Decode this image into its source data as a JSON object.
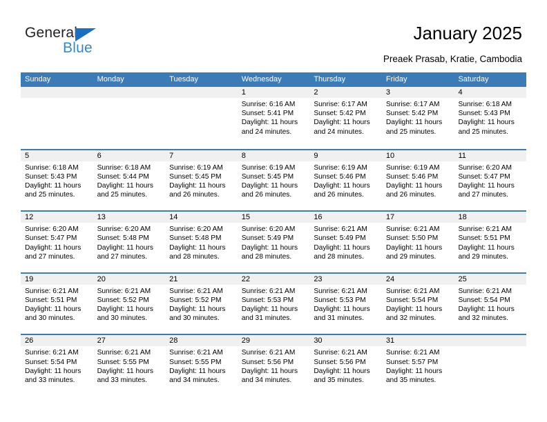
{
  "brand": {
    "name_part1": "General",
    "name_part2": "Blue",
    "triangle_color": "#1b6ec2",
    "blue_color": "#2e8bd0"
  },
  "header": {
    "title": "January 2025",
    "subtitle": "Preaek Prasab, Kratie, Cambodia"
  },
  "theme": {
    "header_blue": "#3b7cb8",
    "day_band_gray": "#f0f0f0"
  },
  "weekdays": [
    "Sunday",
    "Monday",
    "Tuesday",
    "Wednesday",
    "Thursday",
    "Friday",
    "Saturday"
  ],
  "labels": {
    "sunrise_prefix": "Sunrise: ",
    "sunset_prefix": "Sunset: ",
    "daylight_prefix": "Daylight: "
  },
  "weeks": [
    [
      {
        "day": "",
        "sunrise": "",
        "sunset": "",
        "daylight_line1": "",
        "daylight_line2": ""
      },
      {
        "day": "",
        "sunrise": "",
        "sunset": "",
        "daylight_line1": "",
        "daylight_line2": ""
      },
      {
        "day": "",
        "sunrise": "",
        "sunset": "",
        "daylight_line1": "",
        "daylight_line2": ""
      },
      {
        "day": "1",
        "sunrise": "Sunrise: 6:16 AM",
        "sunset": "Sunset: 5:41 PM",
        "daylight_line1": "Daylight: 11 hours",
        "daylight_line2": "and 24 minutes."
      },
      {
        "day": "2",
        "sunrise": "Sunrise: 6:17 AM",
        "sunset": "Sunset: 5:42 PM",
        "daylight_line1": "Daylight: 11 hours",
        "daylight_line2": "and 24 minutes."
      },
      {
        "day": "3",
        "sunrise": "Sunrise: 6:17 AM",
        "sunset": "Sunset: 5:42 PM",
        "daylight_line1": "Daylight: 11 hours",
        "daylight_line2": "and 25 minutes."
      },
      {
        "day": "4",
        "sunrise": "Sunrise: 6:18 AM",
        "sunset": "Sunset: 5:43 PM",
        "daylight_line1": "Daylight: 11 hours",
        "daylight_line2": "and 25 minutes."
      }
    ],
    [
      {
        "day": "5",
        "sunrise": "Sunrise: 6:18 AM",
        "sunset": "Sunset: 5:43 PM",
        "daylight_line1": "Daylight: 11 hours",
        "daylight_line2": "and 25 minutes."
      },
      {
        "day": "6",
        "sunrise": "Sunrise: 6:18 AM",
        "sunset": "Sunset: 5:44 PM",
        "daylight_line1": "Daylight: 11 hours",
        "daylight_line2": "and 25 minutes."
      },
      {
        "day": "7",
        "sunrise": "Sunrise: 6:19 AM",
        "sunset": "Sunset: 5:45 PM",
        "daylight_line1": "Daylight: 11 hours",
        "daylight_line2": "and 26 minutes."
      },
      {
        "day": "8",
        "sunrise": "Sunrise: 6:19 AM",
        "sunset": "Sunset: 5:45 PM",
        "daylight_line1": "Daylight: 11 hours",
        "daylight_line2": "and 26 minutes."
      },
      {
        "day": "9",
        "sunrise": "Sunrise: 6:19 AM",
        "sunset": "Sunset: 5:46 PM",
        "daylight_line1": "Daylight: 11 hours",
        "daylight_line2": "and 26 minutes."
      },
      {
        "day": "10",
        "sunrise": "Sunrise: 6:19 AM",
        "sunset": "Sunset: 5:46 PM",
        "daylight_line1": "Daylight: 11 hours",
        "daylight_line2": "and 26 minutes."
      },
      {
        "day": "11",
        "sunrise": "Sunrise: 6:20 AM",
        "sunset": "Sunset: 5:47 PM",
        "daylight_line1": "Daylight: 11 hours",
        "daylight_line2": "and 27 minutes."
      }
    ],
    [
      {
        "day": "12",
        "sunrise": "Sunrise: 6:20 AM",
        "sunset": "Sunset: 5:47 PM",
        "daylight_line1": "Daylight: 11 hours",
        "daylight_line2": "and 27 minutes."
      },
      {
        "day": "13",
        "sunrise": "Sunrise: 6:20 AM",
        "sunset": "Sunset: 5:48 PM",
        "daylight_line1": "Daylight: 11 hours",
        "daylight_line2": "and 27 minutes."
      },
      {
        "day": "14",
        "sunrise": "Sunrise: 6:20 AM",
        "sunset": "Sunset: 5:48 PM",
        "daylight_line1": "Daylight: 11 hours",
        "daylight_line2": "and 28 minutes."
      },
      {
        "day": "15",
        "sunrise": "Sunrise: 6:20 AM",
        "sunset": "Sunset: 5:49 PM",
        "daylight_line1": "Daylight: 11 hours",
        "daylight_line2": "and 28 minutes."
      },
      {
        "day": "16",
        "sunrise": "Sunrise: 6:21 AM",
        "sunset": "Sunset: 5:49 PM",
        "daylight_line1": "Daylight: 11 hours",
        "daylight_line2": "and 28 minutes."
      },
      {
        "day": "17",
        "sunrise": "Sunrise: 6:21 AM",
        "sunset": "Sunset: 5:50 PM",
        "daylight_line1": "Daylight: 11 hours",
        "daylight_line2": "and 29 minutes."
      },
      {
        "day": "18",
        "sunrise": "Sunrise: 6:21 AM",
        "sunset": "Sunset: 5:51 PM",
        "daylight_line1": "Daylight: 11 hours",
        "daylight_line2": "and 29 minutes."
      }
    ],
    [
      {
        "day": "19",
        "sunrise": "Sunrise: 6:21 AM",
        "sunset": "Sunset: 5:51 PM",
        "daylight_line1": "Daylight: 11 hours",
        "daylight_line2": "and 30 minutes."
      },
      {
        "day": "20",
        "sunrise": "Sunrise: 6:21 AM",
        "sunset": "Sunset: 5:52 PM",
        "daylight_line1": "Daylight: 11 hours",
        "daylight_line2": "and 30 minutes."
      },
      {
        "day": "21",
        "sunrise": "Sunrise: 6:21 AM",
        "sunset": "Sunset: 5:52 PM",
        "daylight_line1": "Daylight: 11 hours",
        "daylight_line2": "and 30 minutes."
      },
      {
        "day": "22",
        "sunrise": "Sunrise: 6:21 AM",
        "sunset": "Sunset: 5:53 PM",
        "daylight_line1": "Daylight: 11 hours",
        "daylight_line2": "and 31 minutes."
      },
      {
        "day": "23",
        "sunrise": "Sunrise: 6:21 AM",
        "sunset": "Sunset: 5:53 PM",
        "daylight_line1": "Daylight: 11 hours",
        "daylight_line2": "and 31 minutes."
      },
      {
        "day": "24",
        "sunrise": "Sunrise: 6:21 AM",
        "sunset": "Sunset: 5:54 PM",
        "daylight_line1": "Daylight: 11 hours",
        "daylight_line2": "and 32 minutes."
      },
      {
        "day": "25",
        "sunrise": "Sunrise: 6:21 AM",
        "sunset": "Sunset: 5:54 PM",
        "daylight_line1": "Daylight: 11 hours",
        "daylight_line2": "and 32 minutes."
      }
    ],
    [
      {
        "day": "26",
        "sunrise": "Sunrise: 6:21 AM",
        "sunset": "Sunset: 5:54 PM",
        "daylight_line1": "Daylight: 11 hours",
        "daylight_line2": "and 33 minutes."
      },
      {
        "day": "27",
        "sunrise": "Sunrise: 6:21 AM",
        "sunset": "Sunset: 5:55 PM",
        "daylight_line1": "Daylight: 11 hours",
        "daylight_line2": "and 33 minutes."
      },
      {
        "day": "28",
        "sunrise": "Sunrise: 6:21 AM",
        "sunset": "Sunset: 5:55 PM",
        "daylight_line1": "Daylight: 11 hours",
        "daylight_line2": "and 34 minutes."
      },
      {
        "day": "29",
        "sunrise": "Sunrise: 6:21 AM",
        "sunset": "Sunset: 5:56 PM",
        "daylight_line1": "Daylight: 11 hours",
        "daylight_line2": "and 34 minutes."
      },
      {
        "day": "30",
        "sunrise": "Sunrise: 6:21 AM",
        "sunset": "Sunset: 5:56 PM",
        "daylight_line1": "Daylight: 11 hours",
        "daylight_line2": "and 35 minutes."
      },
      {
        "day": "31",
        "sunrise": "Sunrise: 6:21 AM",
        "sunset": "Sunset: 5:57 PM",
        "daylight_line1": "Daylight: 11 hours",
        "daylight_line2": "and 35 minutes."
      },
      {
        "day": "",
        "sunrise": "",
        "sunset": "",
        "daylight_line1": "",
        "daylight_line2": ""
      }
    ]
  ]
}
